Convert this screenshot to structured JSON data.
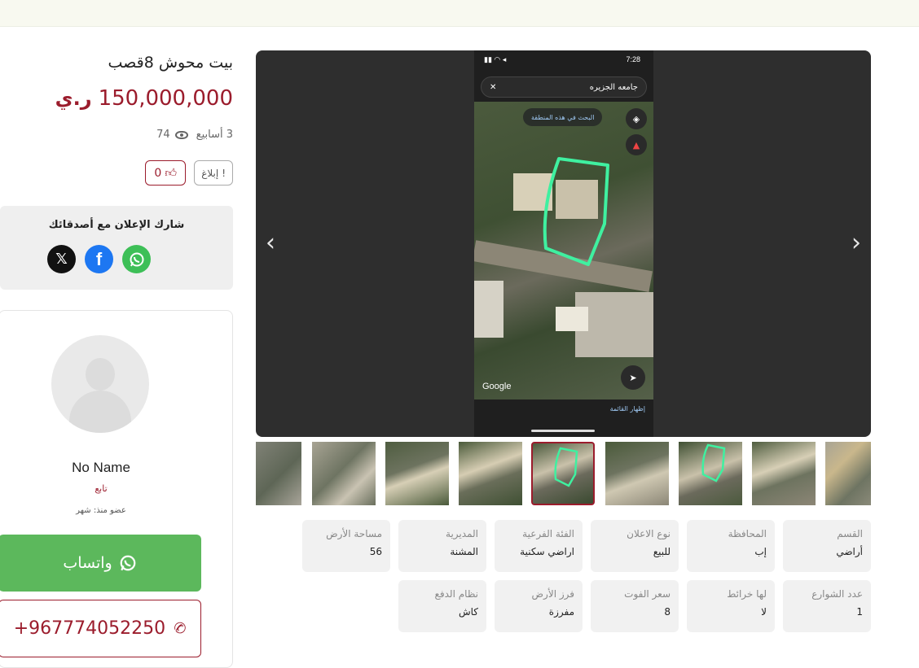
{
  "listing": {
    "title": "بيت محوش 8قصب",
    "price": "150,000,000",
    "currency": "ر.ي",
    "age": "3 أسابيع",
    "views": "74",
    "report_label": "إبلاغ",
    "likes": "0"
  },
  "share": {
    "title": "شارك الإعلان مع أصدقائك",
    "icons": [
      "x-icon",
      "facebook-icon",
      "whatsapp-icon"
    ]
  },
  "seller": {
    "name": "No Name",
    "follow_label": "تابع",
    "member_since": "عضو منذ: شهر"
  },
  "contact": {
    "whatsapp_label": "واتساب",
    "phone": "+967774052250"
  },
  "gallery": {
    "status_time": "7:28",
    "search_text": "جامعه الجزيره",
    "search_area_label": "البحث في هذه المنطقة",
    "map_brand": "Google",
    "list_link": "إظهار القائمة",
    "prev": "‹",
    "next": "›"
  },
  "details": [
    {
      "label": "القسم",
      "value": "أراضي"
    },
    {
      "label": "المحافظة",
      "value": "إب"
    },
    {
      "label": "نوع الاعلان",
      "value": "للبيع"
    },
    {
      "label": "الفئة الفرعية",
      "value": "اراضي سكنية"
    },
    {
      "label": "المديرية",
      "value": "المشنة"
    },
    {
      "label": "مساحة الأرض",
      "value": "56"
    },
    {
      "label": "عدد الشوارع",
      "value": "1"
    },
    {
      "label": "لها خرائط",
      "value": "لا"
    },
    {
      "label": "سعر الفوت",
      "value": "8"
    },
    {
      "label": "فرز الأرض",
      "value": "مفرزة"
    },
    {
      "label": "نظام الدفع",
      "value": "كاش"
    }
  ],
  "colors": {
    "accent": "#9b1c2c",
    "whatsapp": "#5cb85c",
    "polygon": "#3ff0a0"
  }
}
